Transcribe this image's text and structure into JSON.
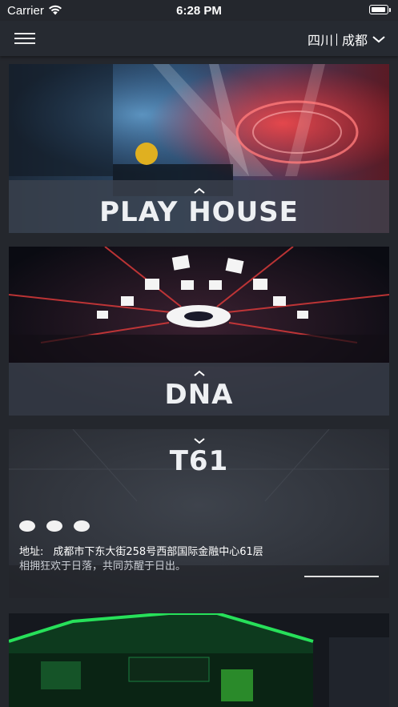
{
  "status_bar": {
    "carrier": "Carrier",
    "time": "6:28 PM"
  },
  "nav": {
    "province": "四川",
    "city": "成都"
  },
  "venues": [
    {
      "name": "PLAY  HOUSE"
    },
    {
      "name": "DNA"
    },
    {
      "name": "T61",
      "address_label": "地址:",
      "address": "成都市下东大街258号西部国际金融中心61层",
      "slogan": "相拥狂欢于日落，共同苏醒于日出。"
    }
  ],
  "colors": {
    "background": "#24272d",
    "overlay": "#3c424e",
    "text": "#ffffff"
  },
  "icons": [
    "menu-icon",
    "wifi-icon",
    "battery-icon",
    "chevron-down-icon",
    "chevron-up-icon"
  ]
}
